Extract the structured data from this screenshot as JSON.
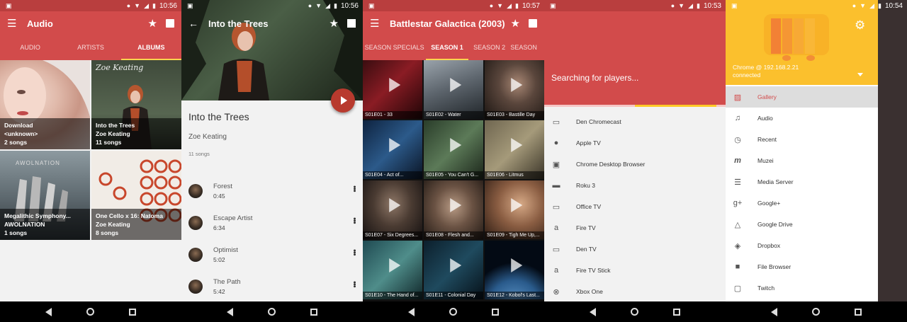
{
  "screens": {
    "s1": {
      "time": "10:56",
      "title": "Audio",
      "tabs": [
        "AUDIO",
        "ARTISTS",
        "ALBUMS"
      ],
      "albums": [
        {
          "line1": "Download",
          "line2": "<unknown>",
          "line3": "2 songs"
        },
        {
          "line1": "Into the Trees",
          "line2": "Zoe Keating",
          "line3": "11 songs"
        },
        {
          "line1": "Megalithic Symphony...",
          "line2": "AWOLNATION",
          "line3": "1 songs"
        },
        {
          "line1": "One Cello x 16: Natoma",
          "line2": "Zoe Keating",
          "line3": "8 songs"
        }
      ],
      "art_text": [
        "Zoe Keating",
        "AWOLNATION"
      ]
    },
    "s2": {
      "time": "10:56",
      "title": "Into the Trees",
      "album_title": "Into the Trees",
      "artist": "Zoe Keating",
      "count": "11 songs",
      "tracks": [
        {
          "name": "Forest",
          "duration": "0:45"
        },
        {
          "name": "Escape Artist",
          "duration": "6:34"
        },
        {
          "name": "Optimist",
          "duration": "5:02"
        },
        {
          "name": "The Path",
          "duration": "5:42"
        }
      ]
    },
    "s3": {
      "time": "10:57",
      "title": "Battlestar Galactica (2003)",
      "tabs": [
        "SEASON SPECIALS",
        "SEASON 1",
        "SEASON 2",
        "SEASON"
      ],
      "episodes": [
        "S01E01 - 33",
        "S01E02 - Water",
        "S01E03 - Bastille Day",
        "S01E04 - Act of...",
        "S01E05 - You Can't G...",
        "S01E06 - Litmus",
        "S01E07 - Six Degrees...",
        "S01E08 - Flesh and...",
        "S01E09 - Tigh Me Up,...",
        "S01E10 - The Hand of...",
        "S01E11 - Colonial Day",
        "S01E12 - Kobol's Last..."
      ]
    },
    "s4": {
      "time": "10:53",
      "searching": "Searching for players...",
      "devices": [
        {
          "name": "Den Chromecast",
          "icon": "cast-icon"
        },
        {
          "name": "Apple TV",
          "icon": "apple-icon"
        },
        {
          "name": "Chrome Desktop Browser",
          "icon": "chrome-icon"
        },
        {
          "name": "Roku 3",
          "icon": "roku-icon"
        },
        {
          "name": "Office TV",
          "icon": "tv-icon"
        },
        {
          "name": "Fire TV",
          "icon": "amazon-icon"
        },
        {
          "name": "Den TV",
          "icon": "tv-icon"
        },
        {
          "name": "Fire TV Stick",
          "icon": "amazon-icon"
        },
        {
          "name": "Xbox One",
          "icon": "xbox-icon"
        }
      ]
    },
    "s5": {
      "time": "10:54",
      "host": "Chrome @ 192.168.2.21",
      "status": "connected",
      "items": [
        {
          "label": "Gallery",
          "icon": "image-icon",
          "active": true
        },
        {
          "label": "Audio",
          "icon": "music-note-icon",
          "active": false
        },
        {
          "label": "Recent",
          "icon": "clock-icon",
          "active": false
        },
        {
          "label": "Muzei",
          "icon": "muzei-icon",
          "active": false
        },
        {
          "label": "Media Server",
          "icon": "server-icon",
          "active": false
        },
        {
          "label": "Google+",
          "icon": "google-plus-icon",
          "active": false
        },
        {
          "label": "Google Drive",
          "icon": "drive-icon",
          "active": false
        },
        {
          "label": "Dropbox",
          "icon": "dropbox-icon",
          "active": false
        },
        {
          "label": "File Browser",
          "icon": "folder-icon",
          "active": false
        },
        {
          "label": "Twitch",
          "icon": "twitch-icon",
          "active": false
        }
      ]
    }
  },
  "colors": {
    "primary": "#d24b4b",
    "status_bar": "#b93e3e",
    "accent": "#ffca28",
    "drawer_header": "#fbc02d",
    "fab": "#b83a2e"
  }
}
